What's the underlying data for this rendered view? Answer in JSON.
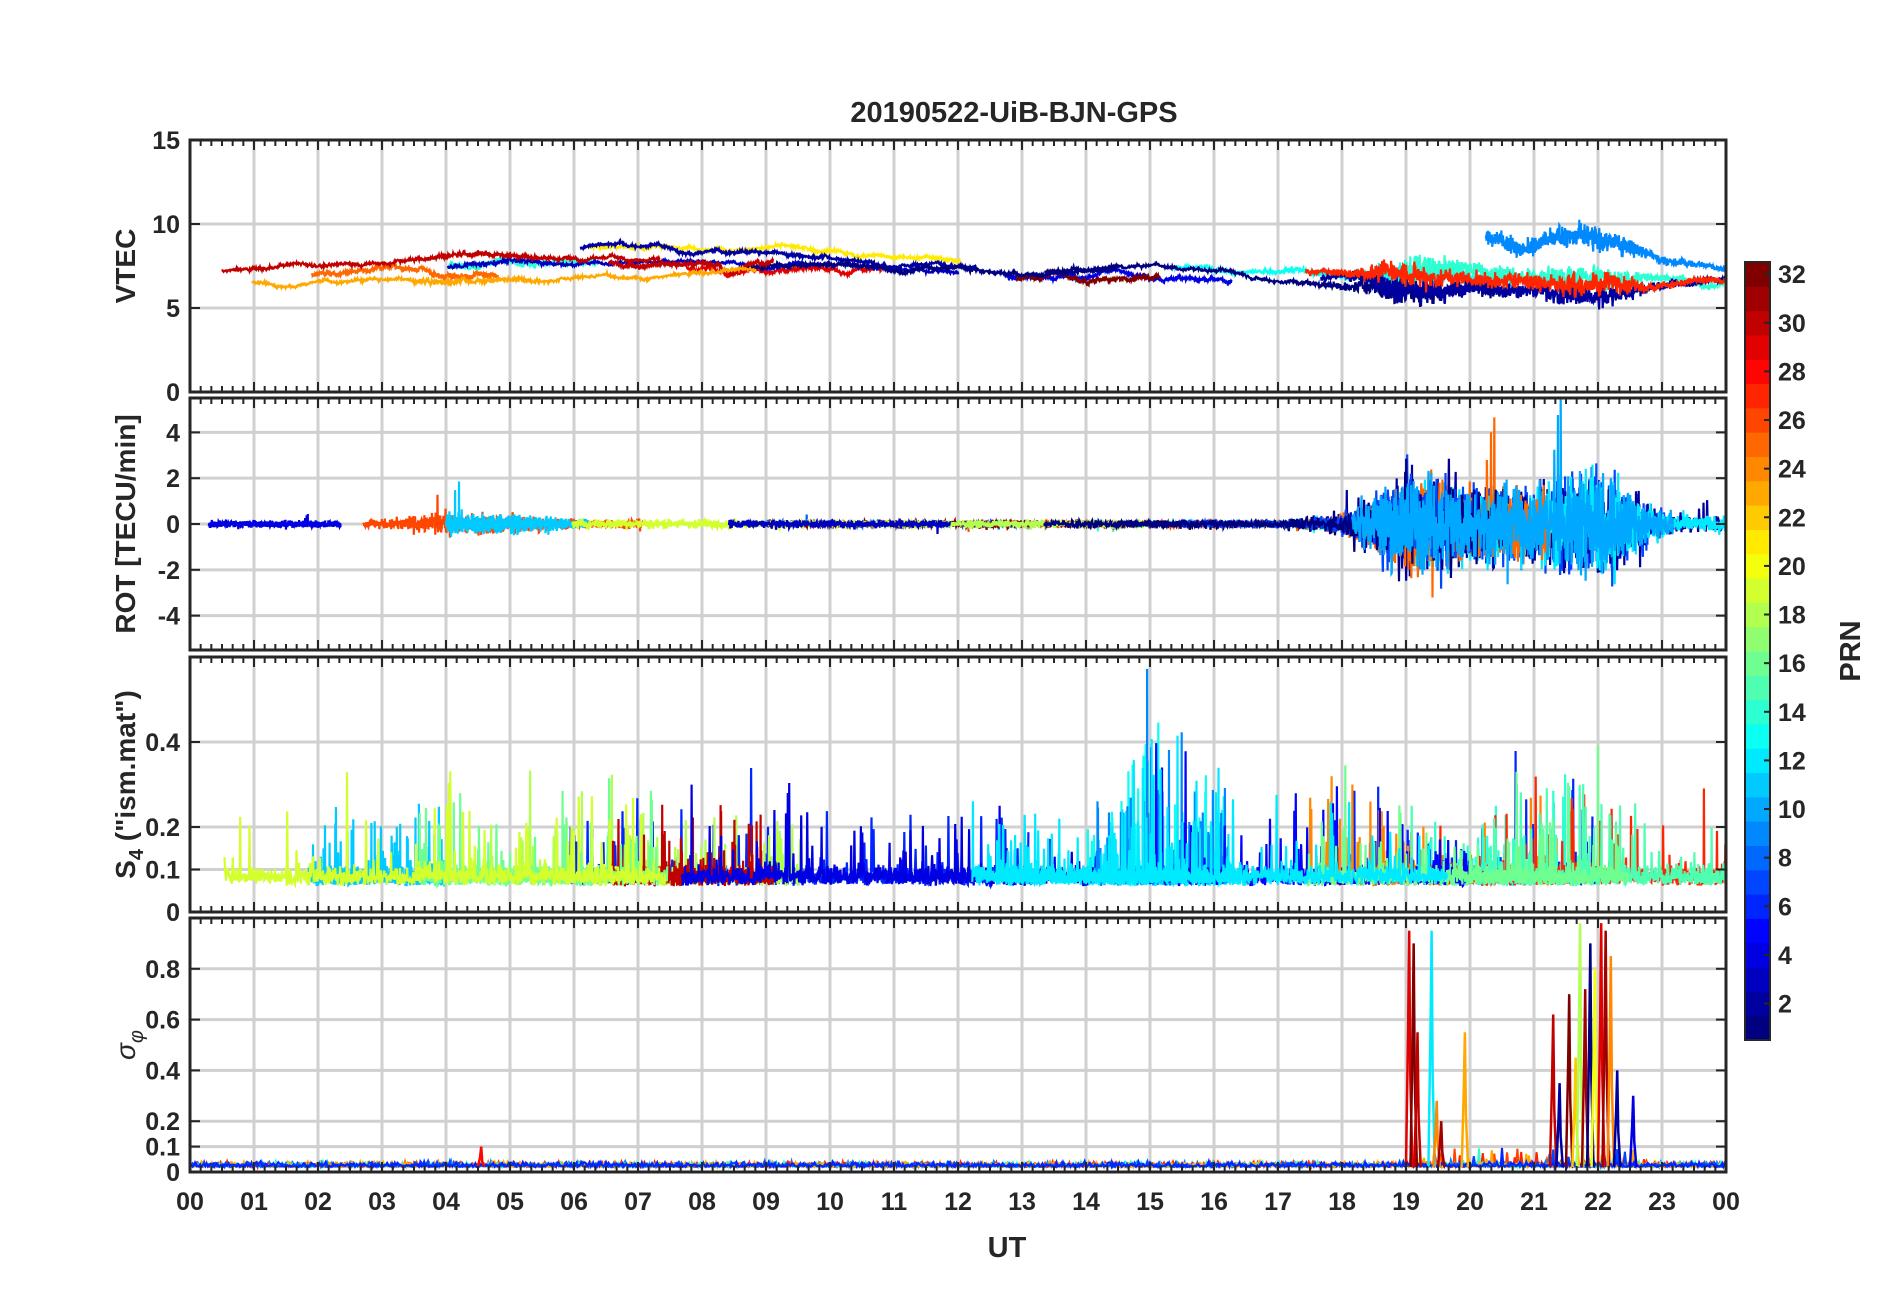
{
  "chart_data": {
    "title": "20190522-UiB-BJN-GPS",
    "type": "line",
    "xlabel": "UT",
    "x_ticks": [
      "00",
      "01",
      "02",
      "03",
      "04",
      "05",
      "06",
      "07",
      "08",
      "09",
      "10",
      "11",
      "12",
      "13",
      "14",
      "15",
      "16",
      "17",
      "18",
      "19",
      "20",
      "21",
      "22",
      "23",
      "00"
    ],
    "xlim": [
      0,
      24
    ],
    "grid": true,
    "colorbar": {
      "label": "PRN",
      "range": [
        1,
        32
      ],
      "ticks": [
        "2",
        "4",
        "6",
        "8",
        "10",
        "12",
        "14",
        "16",
        "18",
        "20",
        "22",
        "24",
        "26",
        "28",
        "30",
        "32"
      ],
      "colormap": "jet",
      "placement": "right"
    },
    "panels": [
      {
        "id": "vtec",
        "ylabel": "VTEC",
        "ylim": [
          0,
          15
        ],
        "y_ticks": [
          0,
          5,
          10,
          15
        ],
        "y_tick_labels": [
          "0",
          "5",
          "10",
          "15"
        ],
        "baseline": [
          7.0,
          7.0,
          7.2,
          7.4,
          7.6,
          7.8,
          7.8,
          7.7,
          7.7,
          7.7,
          7.6,
          7.5,
          7.4,
          7.3,
          7.3,
          7.4,
          7.3,
          7.1,
          7.0,
          7.0,
          7.0,
          6.8,
          6.6,
          6.7,
          6.8
        ],
        "spread": [
          0.6,
          0.6,
          0.7,
          0.8,
          1.2,
          1.1,
          0.9,
          0.9,
          0.8,
          0.8,
          0.8,
          0.6,
          0.5,
          0.5,
          0.5,
          0.5,
          0.6,
          0.6,
          0.9,
          2.2,
          1.6,
          1.6,
          2.0,
          1.0,
          0.8
        ],
        "noise": [
          0.1,
          0.1,
          0.1,
          0.1,
          0.2,
          0.2,
          0.1,
          0.1,
          0.1,
          0.1,
          0.1,
          0.1,
          0.1,
          0.1,
          0.1,
          0.1,
          0.1,
          0.1,
          0.3,
          1.2,
          0.6,
          0.7,
          1.1,
          0.3,
          0.2
        ]
      },
      {
        "id": "rot",
        "ylabel": "ROT [TECU/min]",
        "ylim": [
          -5.5,
          5.5
        ],
        "y_ticks": [
          -4,
          -2,
          0,
          2,
          4
        ],
        "y_tick_labels": [
          "-4",
          "-2",
          "0",
          "2",
          "4"
        ],
        "noise": [
          0.15,
          0.15,
          0.15,
          0.2,
          0.5,
          0.4,
          0.2,
          0.2,
          0.2,
          0.15,
          0.15,
          0.15,
          0.15,
          0.15,
          0.15,
          0.15,
          0.15,
          0.15,
          0.4,
          2.2,
          1.6,
          1.6,
          2.4,
          0.5,
          0.3
        ]
      },
      {
        "id": "s4",
        "ylabel": "S4 (\"ism.mat\")",
        "ylabel_main": "S",
        "ylabel_sub": "4",
        "ylabel_rest": " (\"ism.mat\")",
        "ylim": [
          0,
          0.6
        ],
        "y_ticks": [
          0,
          0.1,
          0.2,
          0.4
        ],
        "y_tick_labels": [
          "0",
          "0.1",
          "0.2",
          "0.4"
        ],
        "baseline": [
          0.06,
          0.06,
          0.06,
          0.06,
          0.06,
          0.06,
          0.06,
          0.06,
          0.06,
          0.06,
          0.06,
          0.06,
          0.06,
          0.06,
          0.06,
          0.06,
          0.06,
          0.06,
          0.06,
          0.06,
          0.06,
          0.06,
          0.06,
          0.06,
          0.06
        ],
        "burst": [
          0.15,
          0.17,
          0.13,
          0.12,
          0.22,
          0.14,
          0.18,
          0.17,
          0.1,
          0.2,
          0.18,
          0.1,
          0.13,
          0.14,
          0.1,
          0.3,
          0.18,
          0.14,
          0.2,
          0.12,
          0.1,
          0.17,
          0.22,
          0.12,
          0.1
        ]
      },
      {
        "id": "sigma_phi",
        "ylabel": "σ φ",
        "ylabel_main": "σ",
        "ylabel_sub": "φ",
        "ylim": [
          0,
          1
        ],
        "y_ticks": [
          0,
          0.1,
          0.2,
          0.4,
          0.6,
          0.8
        ],
        "y_tick_labels": [
          "0",
          "0.1",
          "0.2",
          "0.4",
          "0.6",
          "0.8"
        ],
        "baseline": 0.02,
        "spikes": [
          {
            "t": 4.55,
            "v": 0.1,
            "prn": 28
          },
          {
            "t": 19.05,
            "v": 0.95,
            "prn": 29
          },
          {
            "t": 19.12,
            "v": 0.9,
            "prn": 32
          },
          {
            "t": 19.18,
            "v": 0.55,
            "prn": 30
          },
          {
            "t": 19.4,
            "v": 0.95,
            "prn": 12
          },
          {
            "t": 19.48,
            "v": 0.28,
            "prn": 24
          },
          {
            "t": 19.55,
            "v": 0.2,
            "prn": 31
          },
          {
            "t": 19.92,
            "v": 0.55,
            "prn": 23
          },
          {
            "t": 21.3,
            "v": 0.62,
            "prn": 30
          },
          {
            "t": 21.4,
            "v": 0.35,
            "prn": 2
          },
          {
            "t": 21.55,
            "v": 0.7,
            "prn": 32
          },
          {
            "t": 21.65,
            "v": 0.45,
            "prn": 22
          },
          {
            "t": 21.72,
            "v": 0.98,
            "prn": 18
          },
          {
            "t": 21.8,
            "v": 0.72,
            "prn": 31
          },
          {
            "t": 21.88,
            "v": 0.9,
            "prn": 1
          },
          {
            "t": 21.95,
            "v": 0.8,
            "prn": 20
          },
          {
            "t": 22.05,
            "v": 0.98,
            "prn": 29
          },
          {
            "t": 22.12,
            "v": 0.95,
            "prn": 31
          },
          {
            "t": 22.2,
            "v": 0.85,
            "prn": 24
          },
          {
            "t": 22.3,
            "v": 0.4,
            "prn": 2
          },
          {
            "t": 22.55,
            "v": 0.3,
            "prn": 4
          }
        ]
      }
    ]
  }
}
